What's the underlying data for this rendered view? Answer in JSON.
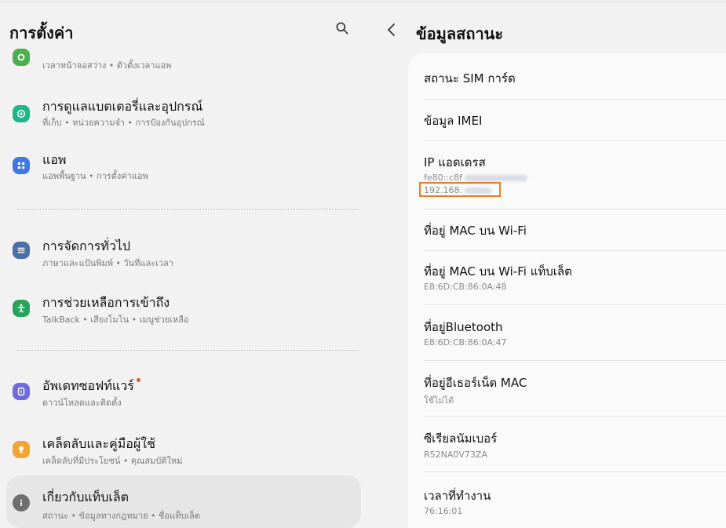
{
  "left": {
    "title": "การตั้งค่า",
    "items": [
      {
        "title": "",
        "subtitle": "เวลาหน้าจอสว่าง • ตัวตั้งเวลาแอพ",
        "icon": "display-icon",
        "color": "#4caf50"
      },
      {
        "title": "การดูแลแบตเตอรี่และอุปกรณ์",
        "subtitle": "ที่เก็บ • หน่วยความจำ • การป้องกันอุปกรณ์",
        "icon": "device-care-icon",
        "color": "#1fb58a"
      },
      {
        "title": "แอพ",
        "subtitle": "แอพพื้นฐาน • การตั้งค่าแอพ",
        "icon": "apps-icon",
        "color": "#3f78e0"
      },
      {
        "title": "การจัดการทั่วไป",
        "subtitle": "ภาษาและแป้นพิมพ์ • วันที่และเวลา",
        "icon": "sliders-icon",
        "color": "#4b6fa8"
      },
      {
        "title": "การช่วยเหลือการเข้าถึง",
        "subtitle": "TalkBack • เสียงโมโน • เมนูช่วยเหลือ",
        "icon": "accessibility-icon",
        "color": "#27a35c"
      },
      {
        "title": "อัพเดทซอฟท์แวร์",
        "subtitle": "ดาวน์โหลดและติดตั้ง",
        "icon": "update-icon",
        "color": "#6f6cd9"
      },
      {
        "title": "เคล็ดลับและคู่มือผู้ใช้",
        "subtitle": "เคล็ดลับที่มีประโยชน์ • คุณสมบัติใหม่",
        "icon": "tips-icon",
        "color": "#f2a530"
      },
      {
        "title": "เกี่ยวกับแท็บเล็ต",
        "subtitle": "สถานะ • ข้อมูลทางกฎหมาย • ชื่อแท็บเล็ต",
        "icon": "info-icon",
        "color": "#6e6e6e"
      }
    ]
  },
  "right": {
    "title": "ข้อมูลสถานะ",
    "rows": [
      {
        "title": "สถานะ SIM การ์ด",
        "value": ""
      },
      {
        "title": "ข้อมูล IMEI",
        "value": ""
      },
      {
        "title": "IP แอดเดรส",
        "value": "fe80::c8f",
        "value2": "192.168."
      },
      {
        "title": "ที่อยู่ MAC บน Wi-Fi",
        "value": ""
      },
      {
        "title": "ที่อยู่ MAC บน Wi-Fi แท็บเล็ต",
        "value": "E8:6D:CB:86:0A:48"
      },
      {
        "title": "ที่อยู่Bluetooth",
        "value": "E8:6D:CB:86:0A:47"
      },
      {
        "title": "ที่อยู่อีเธอร์เน็ต MAC",
        "value": "ใช้ไม่ได้"
      },
      {
        "title": "ซีเรียลนัมเบอร์",
        "value": "R52NA0V73ZA"
      },
      {
        "title": "เวลาที่ทำงาน",
        "value": "76:16:01"
      }
    ]
  },
  "colors": {
    "highlight": "#f07a22",
    "update_dot": "#e05a2b"
  }
}
